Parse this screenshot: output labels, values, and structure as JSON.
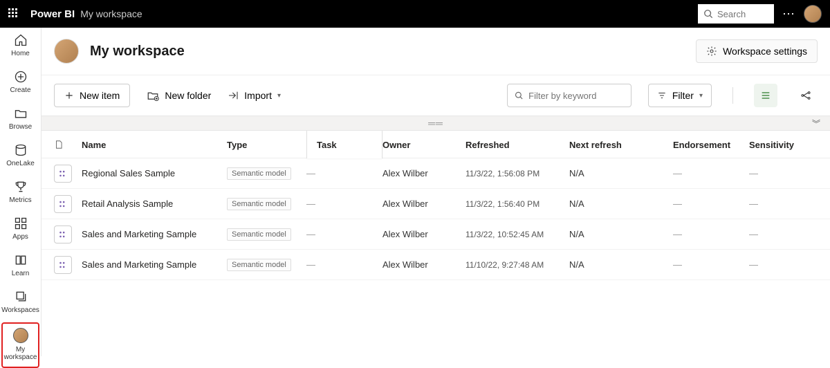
{
  "topbar": {
    "brand": "Power BI",
    "context": "My workspace",
    "search_placeholder": "Search"
  },
  "leftnav": [
    {
      "label": "Home"
    },
    {
      "label": "Create"
    },
    {
      "label": "Browse"
    },
    {
      "label": "OneLake"
    },
    {
      "label": "Metrics"
    },
    {
      "label": "Apps"
    },
    {
      "label": "Learn"
    },
    {
      "label": "Workspaces"
    },
    {
      "label": "My workspace"
    }
  ],
  "header": {
    "title": "My workspace",
    "settings_label": "Workspace settings"
  },
  "toolbar": {
    "new_item": "New item",
    "new_folder": "New folder",
    "import": "Import",
    "filter_placeholder": "Filter by keyword",
    "filter_label": "Filter"
  },
  "columns": {
    "name": "Name",
    "type": "Type",
    "task": "Task",
    "owner": "Owner",
    "refreshed": "Refreshed",
    "next_refresh": "Next refresh",
    "endorsement": "Endorsement",
    "sensitivity": "Sensitivity"
  },
  "rows": [
    {
      "name": "Regional Sales Sample",
      "type": "Semantic model",
      "task": "—",
      "owner": "Alex Wilber",
      "refreshed": "11/3/22, 1:56:08 PM",
      "next_refresh": "N/A",
      "endorsement": "—",
      "sensitivity": "—"
    },
    {
      "name": "Retail Analysis Sample",
      "type": "Semantic model",
      "task": "—",
      "owner": "Alex Wilber",
      "refreshed": "11/3/22, 1:56:40 PM",
      "next_refresh": "N/A",
      "endorsement": "—",
      "sensitivity": "—"
    },
    {
      "name": "Sales and Marketing Sample",
      "type": "Semantic model",
      "task": "—",
      "owner": "Alex Wilber",
      "refreshed": "11/3/22, 10:52:45 AM",
      "next_refresh": "N/A",
      "endorsement": "—",
      "sensitivity": "—"
    },
    {
      "name": "Sales and Marketing Sample",
      "type": "Semantic model",
      "task": "—",
      "owner": "Alex Wilber",
      "refreshed": "11/10/22, 9:27:48 AM",
      "next_refresh": "N/A",
      "endorsement": "—",
      "sensitivity": "—"
    }
  ]
}
